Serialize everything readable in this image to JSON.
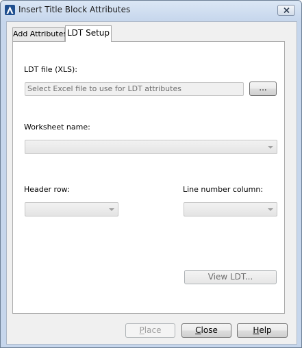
{
  "window": {
    "title": "Insert Title Block Attributes"
  },
  "tabs": [
    {
      "label": "Add Attributes",
      "selected": false
    },
    {
      "label": "LDT Setup",
      "selected": true
    }
  ],
  "ldt_file": {
    "label": "LDT file (XLS):",
    "placeholder": "Select Excel file to use for LDT attributes",
    "browse_label": "..."
  },
  "worksheet": {
    "label": "Worksheet name:",
    "value": ""
  },
  "header_row": {
    "label": "Header row:",
    "value": ""
  },
  "line_number_column": {
    "label": "Line number column:",
    "value": ""
  },
  "view_ldt_label": "View LDT...",
  "footer": {
    "place": {
      "mnemonic": "P",
      "rest": "lace",
      "enabled": false
    },
    "close": {
      "mnemonic": "C",
      "rest": "lose"
    },
    "help": {
      "mnemonic": "H",
      "rest": "elp"
    }
  },
  "icons": {
    "app": "autocad-a-icon",
    "close": "close-icon",
    "dropdown": "chevron-down-icon"
  }
}
